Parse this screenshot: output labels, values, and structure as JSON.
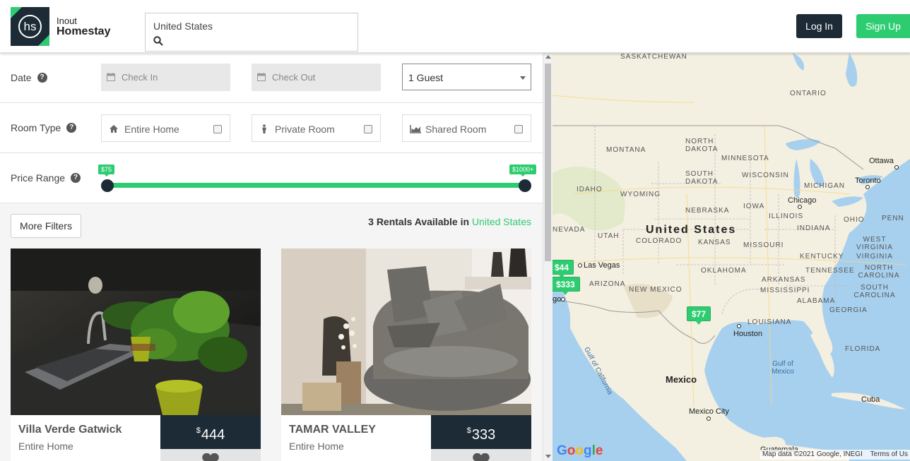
{
  "colors": {
    "navy": "#1c2b36",
    "green": "#2ecc71"
  },
  "header": {
    "logo_mark": "hs",
    "logo_line1": "Inout",
    "logo_line2": "Homestay",
    "search_value": "United States",
    "search_icon": "search-icon",
    "login_label": "Log In",
    "signup_label": "Sign Up"
  },
  "filters": {
    "date_label": "Date",
    "check_in_placeholder": "Check In",
    "check_out_placeholder": "Check Out",
    "guests_value": "1 Guest",
    "room_type_label": "Room Type",
    "room_types": [
      {
        "label": "Entire Home",
        "icon": "home-icon",
        "checked": false
      },
      {
        "label": "Private Room",
        "icon": "person-icon",
        "checked": false
      },
      {
        "label": "Shared Room",
        "icon": "area-chart-icon",
        "checked": false
      }
    ],
    "price_label": "Price Range",
    "price_min": "$75",
    "price_max": "$1000+",
    "help_glyph": "?"
  },
  "results": {
    "more_filters_label": "More Filters",
    "count_text": "3 Rentals Available in",
    "count_location": "United States",
    "listings": [
      {
        "name": "Villa Verde Gatwick",
        "type": "Entire Home",
        "currency": "$",
        "price": "444"
      },
      {
        "name": "TAMAR VALLEY",
        "type": "Entire Home",
        "currency": "$",
        "price": "333"
      }
    ]
  },
  "map": {
    "regions": [
      "SASKATCHEWAN",
      "ONTARIO",
      "NORTH DAKOTA",
      "MONTANA",
      "MINNESOTA",
      "SOUTH DAKOTA",
      "WISCONSIN",
      "MICHIGAN",
      "IDAHO",
      "WYOMING",
      "NEBRASKA",
      "IOWA",
      "ILLINOIS",
      "OHIO",
      "PENN",
      "NEVADA",
      "UTAH",
      "COLORADO",
      "KANSAS",
      "MISSOURI",
      "INDIANA",
      "WEST VIRGINIA",
      "KENTUCKY",
      "VIRGINIA",
      "ARIZONA",
      "NEW MEXICO",
      "OKLAHOMA",
      "ARKANSAS",
      "TENNESSEE",
      "NORTH CAROLINA",
      "SOUTH CAROLINA",
      "MISSISSIPPI",
      "ALABAMA",
      "GEORGIA",
      "LOUISIANA",
      "FLORIDA"
    ],
    "countries": [
      "United States",
      "Mexico"
    ],
    "cities": [
      "Ottawa",
      "Toronto",
      "Chicago",
      "Las Vegas",
      "Houston",
      "Mexico City",
      "Cuba",
      "Guatemala",
      "go"
    ],
    "waters": [
      "Gulf of California",
      "Gulf of Mexico"
    ],
    "pins": [
      "$44",
      "$333",
      "$77"
    ],
    "google_logo": "Google",
    "attribution": "Map data ©2021 Google, INEGI",
    "terms": "Terms of Us"
  }
}
